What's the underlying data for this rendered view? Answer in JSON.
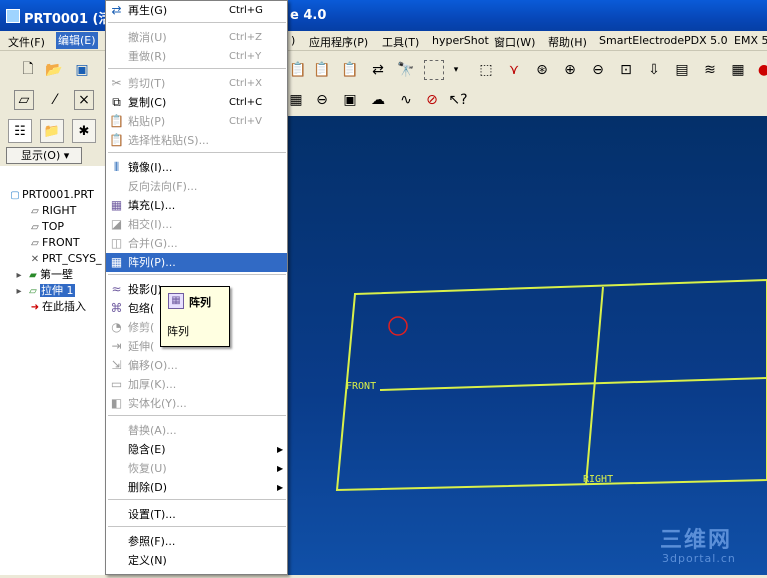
{
  "titlebar": {
    "title_left": "PRT0001 (活",
    "title_right": "e 4.0"
  },
  "menubar": {
    "file": "文件(F)",
    "edit": "编辑(E)",
    "partial": ")",
    "apps": "应用程序(P)",
    "tools": "工具(T)",
    "hypershot": "hyperShot",
    "window": "窗口(W)",
    "help": "帮助(H)",
    "smartelectrode": "SmartElectrode",
    "pdx": "PDX 5.0",
    "emx": "EMX 5."
  },
  "panel": {
    "show_label": "显示(O) ▾",
    "tree": [
      "PRT0001.PRT",
      "RIGHT",
      "TOP",
      "FRONT",
      "PRT_CSYS_",
      "第一壁",
      "拉伸 1",
      "在此插入"
    ]
  },
  "edit_menu": {
    "items": [
      {
        "label": "再生(G)",
        "shortcut": "Ctrl+G"
      },
      {
        "label": "撤消(U)",
        "shortcut": "Ctrl+Z"
      },
      {
        "label": "重做(R)",
        "shortcut": "Ctrl+Y"
      },
      {
        "label": "剪切(T)",
        "shortcut": "Ctrl+X"
      },
      {
        "label": "复制(C)",
        "shortcut": "Ctrl+C"
      },
      {
        "label": "粘贴(P)",
        "shortcut": "Ctrl+V"
      },
      {
        "label": "选择性粘贴(S)...",
        "shortcut": ""
      },
      {
        "label": "镜像(I)...",
        "shortcut": ""
      },
      {
        "label": "反向法向(F)...",
        "shortcut": ""
      },
      {
        "label": "填充(L)...",
        "shortcut": ""
      },
      {
        "label": "相交(I)...",
        "shortcut": ""
      },
      {
        "label": "合并(G)...",
        "shortcut": ""
      },
      {
        "label": "阵列(P)...",
        "shortcut": ""
      },
      {
        "label": "投影(J)...",
        "shortcut": ""
      },
      {
        "label": "包络(",
        "shortcut": ""
      },
      {
        "label": "修剪(",
        "shortcut": ""
      },
      {
        "label": "延伸(",
        "shortcut": ""
      },
      {
        "label": "偏移(O)...",
        "shortcut": ""
      },
      {
        "label": "加厚(K)...",
        "shortcut": ""
      },
      {
        "label": "实体化(Y)...",
        "shortcut": ""
      },
      {
        "label": "替换(A)...",
        "shortcut": ""
      },
      {
        "label": "隐含(E)",
        "shortcut": ""
      },
      {
        "label": "恢复(U)",
        "shortcut": ""
      },
      {
        "label": "删除(D)",
        "shortcut": ""
      },
      {
        "label": "设置(T)...",
        "shortcut": ""
      },
      {
        "label": "参照(F)...",
        "shortcut": ""
      },
      {
        "label": "定义(N)",
        "shortcut": ""
      }
    ]
  },
  "tooltip": {
    "title": "阵列",
    "body": "阵列"
  },
  "viewport": {
    "front_label": "FRONT",
    "right_label": "RIGHT"
  },
  "watermark": {
    "main": "三维网",
    "sub": "3dportal.cn"
  }
}
